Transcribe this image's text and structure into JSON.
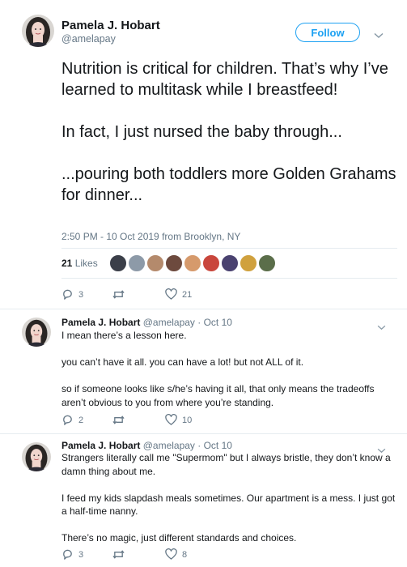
{
  "main_tweet": {
    "author_name": "Pamela J. Hobart",
    "author_handle": "@amelapay",
    "follow_label": "Follow",
    "paragraphs": [
      "Nutrition is critical for children. That’s why I’ve learned to multitask while I breastfeed!",
      "In fact, I just nursed the baby through...",
      "...pouring both toddlers more Golden Grahams for dinner..."
    ],
    "timestamp": "2:50 PM - 10 Oct 2019 from Brooklyn, NY",
    "likes_count": "21",
    "likes_label": "Likes",
    "reply_count": "3",
    "retweet_count": "",
    "like_count": "21"
  },
  "replies": [
    {
      "author_name": "Pamela J. Hobart",
      "handle_date": "@amelapay · Oct 10",
      "paragraphs": [
        "I mean there’s a lesson here.",
        "you can’t have it all. you can have a lot! but not ALL of it.",
        "so if someone looks like s/he’s having it all, that only means the tradeoffs aren’t obvious to you from where you’re standing."
      ],
      "reply_count": "2",
      "retweet_count": "",
      "like_count": "10"
    },
    {
      "author_name": "Pamela J. Hobart",
      "handle_date": "@amelapay · Oct 10",
      "paragraphs": [
        "Strangers literally call me \"Supermom\" but I always bristle, they don’t know a damn thing about me.",
        "I feed my kids slapdash meals sometimes. Our apartment is a mess. I just got a half-time nanny.",
        "There’s no magic, just different standards and choices."
      ],
      "reply_count": "3",
      "retweet_count": "",
      "like_count": "8"
    }
  ],
  "icons": {
    "reply": "reply-icon",
    "retweet": "retweet-icon",
    "like": "heart-icon",
    "more": "chevron-down-icon"
  },
  "colors": {
    "accent": "#1da1f2",
    "secondary_text": "#657786",
    "divider": "#e6ecf0"
  }
}
